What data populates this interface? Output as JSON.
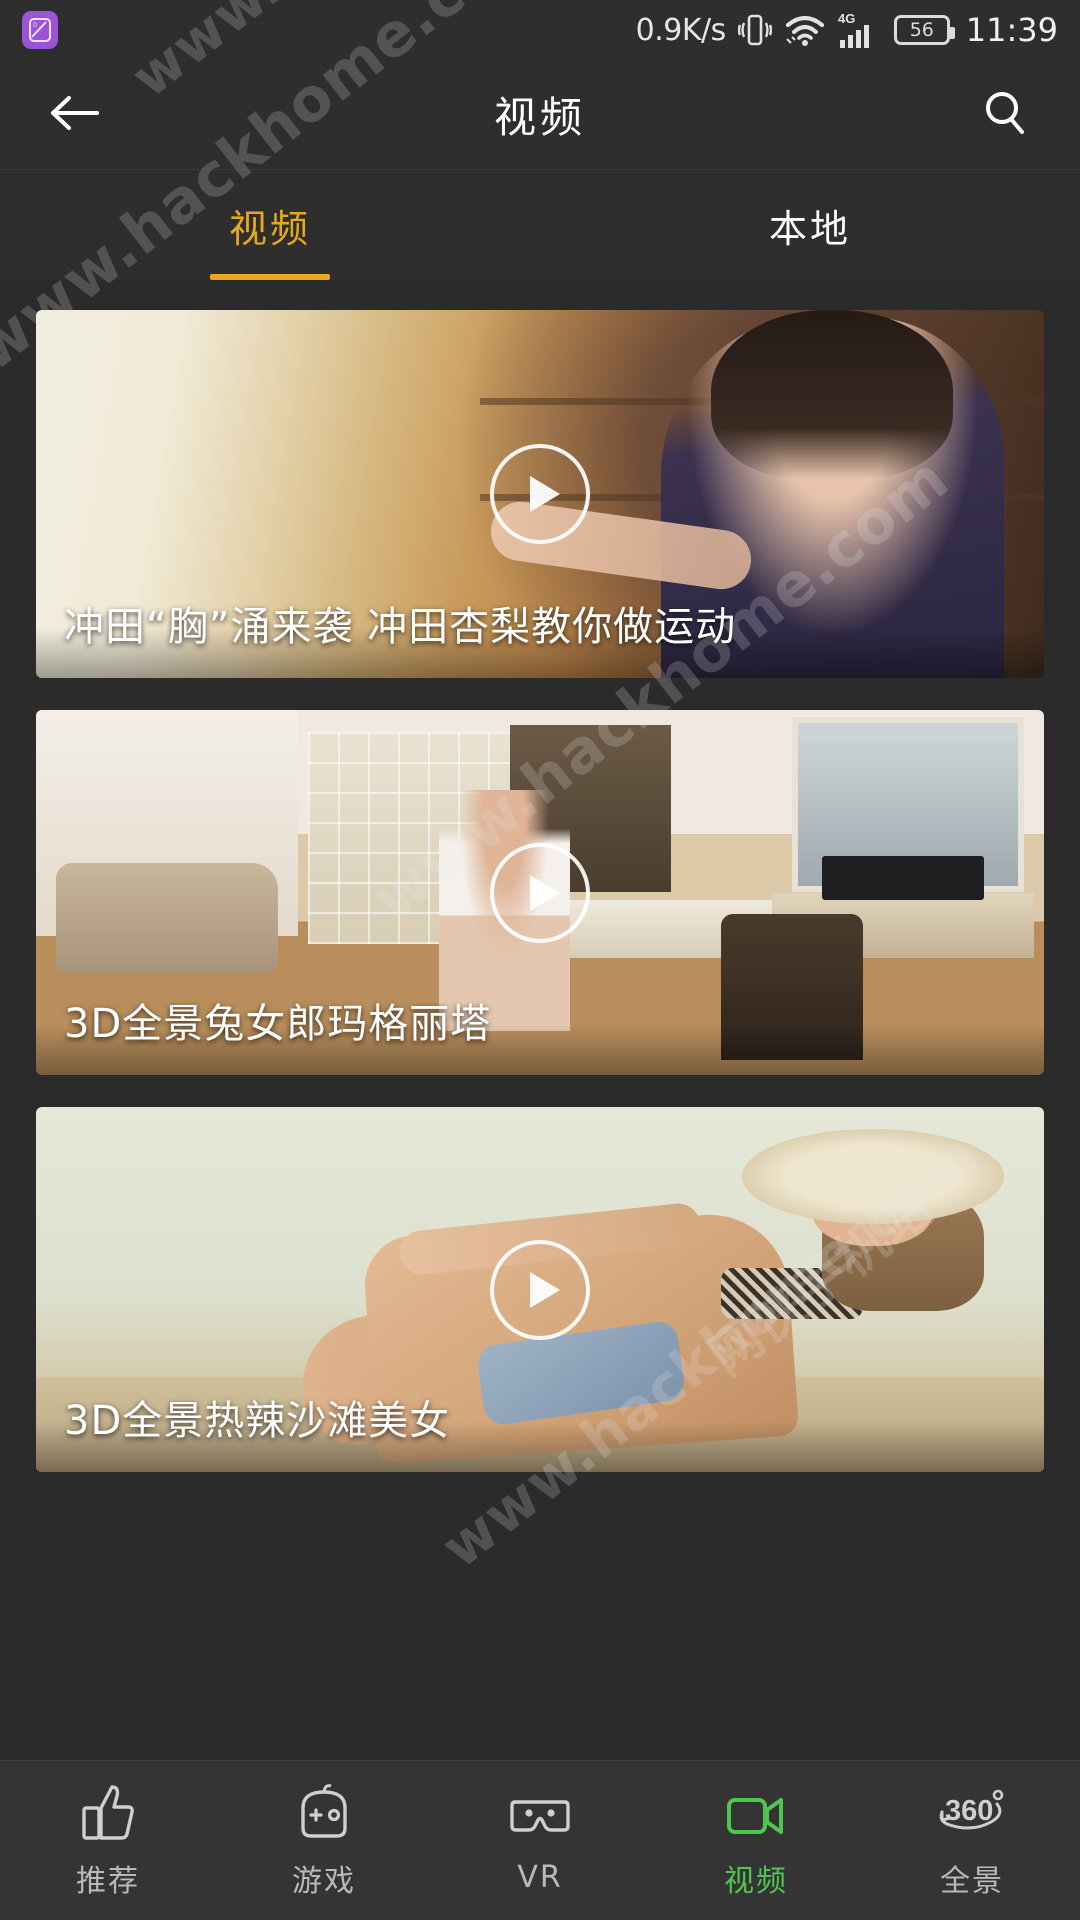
{
  "statusbar": {
    "app_badge_icon": "photo-app-icon",
    "network_speed": "0.9K/s",
    "vibrate_icon": "vibrate-icon",
    "wifi_icon": "wifi-icon",
    "signal_icon": "signal-4g-icon",
    "signal_label": "4G",
    "battery_level": "56",
    "clock": "11:39"
  },
  "header": {
    "back_icon": "back-arrow-icon",
    "title": "视频",
    "search_icon": "search-icon"
  },
  "tabs": [
    {
      "label": "视频",
      "active": true
    },
    {
      "label": "本地",
      "active": false
    }
  ],
  "colors": {
    "tab_active": "#e8a81c",
    "nav_active": "#4fc64f",
    "background": "#2b2b2b",
    "bar_background": "#2e2e2e",
    "nav_background": "#343434"
  },
  "videos": [
    {
      "title": "冲田“胸”涌来袭 冲田杏梨教你做运动",
      "play_icon": "play-icon"
    },
    {
      "title": "3D全景兔女郎玛格丽塔",
      "play_icon": "play-icon"
    },
    {
      "title": "3D全景热辣沙滩美女",
      "play_icon": "play-icon"
    }
  ],
  "bottom_nav": [
    {
      "label": "推荐",
      "icon": "thumbs-up-icon",
      "active": false
    },
    {
      "label": "游戏",
      "icon": "game-robot-icon",
      "active": false
    },
    {
      "label": "VR",
      "icon": "vr-headset-icon",
      "active": false
    },
    {
      "label": "视频",
      "icon": "video-camera-icon",
      "active": true
    },
    {
      "label": "全景",
      "icon": "panorama-360-icon",
      "active": false
    }
  ],
  "watermarks": [
    "www.hackhome.com",
    "www.hackhome.com",
    "www.hackhome.com",
    "网侠手机站",
    "www.hackhome.com"
  ]
}
